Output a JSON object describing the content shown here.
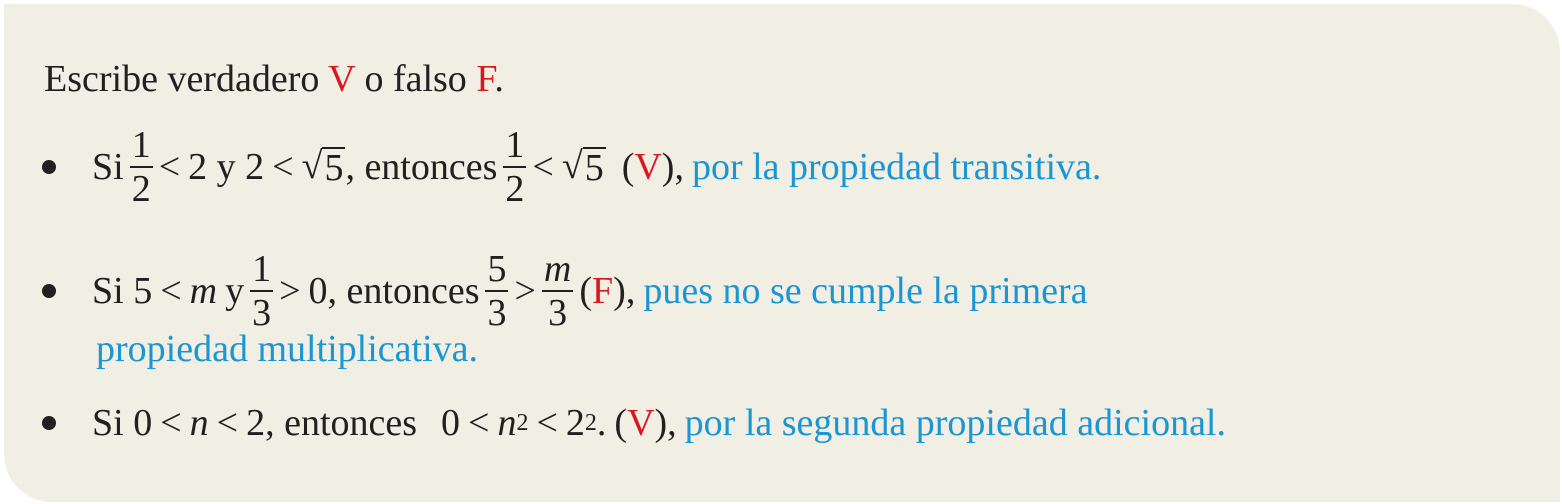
{
  "heading": {
    "text_before": "Escribe verdadero ",
    "v_letter": "V",
    "text_middle": " o falso ",
    "f_letter": "F",
    "text_end": "."
  },
  "items": [
    {
      "si": "Si",
      "frac1_num": "1",
      "frac1_den": "2",
      "lt1": "<",
      "part_a": "2 y 2",
      "lt2": "<",
      "sqrt_radical": "√",
      "sqrt_arg": "5",
      "entonces": ", entonces",
      "frac2_num": "1",
      "frac2_den": "2",
      "lt3": "<",
      "sqrt2_radical": "√",
      "sqrt2_arg": "5",
      "open_paren": "(",
      "verdict": "V",
      "close_paren": "),",
      "explanation": "por la propiedad transitiva."
    },
    {
      "si": "Si 5",
      "lt1": "<",
      "var_m": "m",
      "y": "y",
      "frac1_num": "1",
      "frac1_den": "3",
      "gt1": ">",
      "zero": "0, entonces",
      "frac2_num": "5",
      "frac2_den": "3",
      "gt2": ">",
      "frac3_num": "m",
      "frac3_den": "3",
      "open_paren": "(",
      "verdict": "F",
      "close_paren": "),",
      "explanation": "pues no se cumple la primera",
      "explanation_line2": "propiedad multiplicativa."
    },
    {
      "si": "Si 0",
      "lt1": "<",
      "var_n": "n",
      "lt2": "<",
      "two": "2, entonces",
      "zero": "0",
      "lt3": "<",
      "var_n2": "n",
      "exp1": "2",
      "lt4": "<",
      "two2": "2",
      "exp2": "2",
      "period": ".",
      "open_paren": "(",
      "verdict": "V",
      "close_paren": "),",
      "explanation": "por la segunda propiedad adicional."
    }
  ],
  "colors": {
    "card_background": "#f1eee4",
    "text": "#231f20",
    "verdict_red": "#d7191f",
    "explanation_blue": "#1a96d3"
  }
}
